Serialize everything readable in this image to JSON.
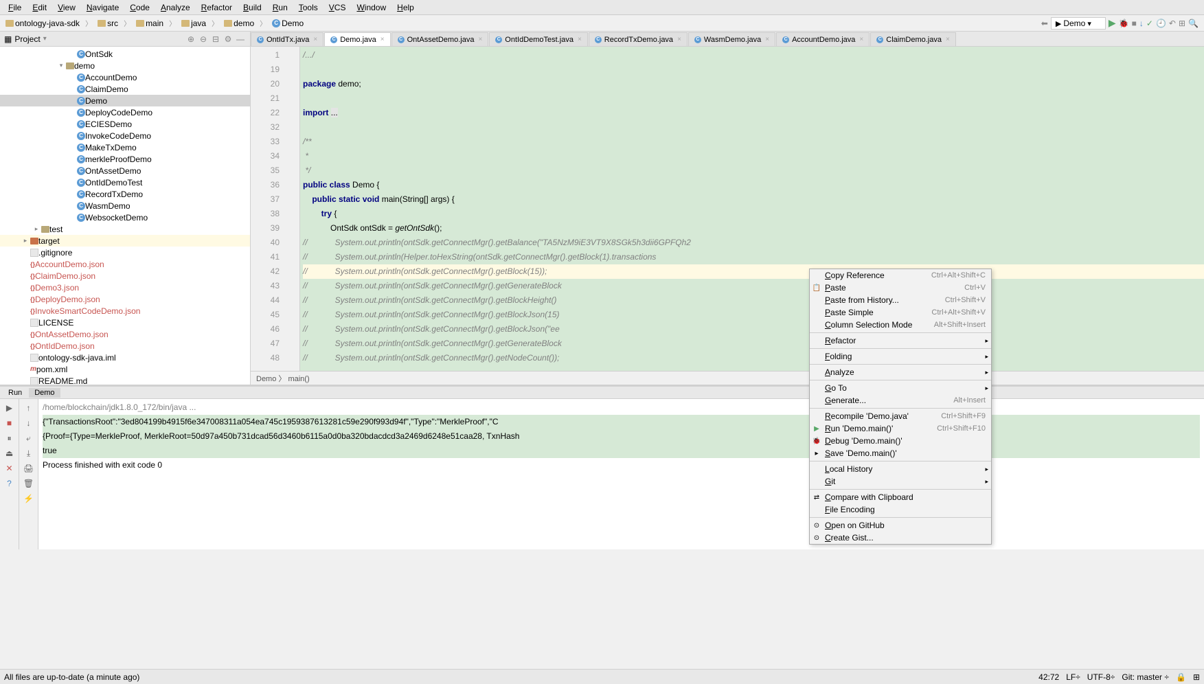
{
  "menus": [
    "File",
    "Edit",
    "View",
    "Navigate",
    "Code",
    "Analyze",
    "Refactor",
    "Build",
    "Run",
    "Tools",
    "VCS",
    "Window",
    "Help"
  ],
  "breadcrumbs": [
    {
      "icon": "folder",
      "label": "ontology-java-sdk"
    },
    {
      "icon": "folder",
      "label": "src"
    },
    {
      "icon": "folder",
      "label": "main"
    },
    {
      "icon": "folder",
      "label": "java"
    },
    {
      "icon": "folder",
      "label": "demo"
    },
    {
      "icon": "class",
      "label": "Demo"
    }
  ],
  "run_config": "Demo",
  "sidebar_title": "Project",
  "tree": {
    "items": [
      {
        "indent": 3,
        "icon": "class",
        "label": "OntSdk"
      },
      {
        "indent": 2,
        "icon": "pkg",
        "label": "demo",
        "expander": "▾"
      },
      {
        "indent": 3,
        "icon": "class",
        "label": "AccountDemo"
      },
      {
        "indent": 3,
        "icon": "class",
        "label": "ClaimDemo"
      },
      {
        "indent": 3,
        "icon": "class",
        "label": "Demo",
        "selected": true
      },
      {
        "indent": 3,
        "icon": "class",
        "label": "DeployCodeDemo"
      },
      {
        "indent": 3,
        "icon": "class",
        "label": "ECIESDemo"
      },
      {
        "indent": 3,
        "icon": "class",
        "label": "InvokeCodeDemo"
      },
      {
        "indent": 3,
        "icon": "class",
        "label": "MakeTxDemo"
      },
      {
        "indent": 3,
        "icon": "class",
        "label": "merkleProofDemo"
      },
      {
        "indent": 3,
        "icon": "class",
        "label": "OntAssetDemo"
      },
      {
        "indent": 3,
        "icon": "class",
        "label": "OntIdDemoTest"
      },
      {
        "indent": 3,
        "icon": "class",
        "label": "RecordTxDemo"
      },
      {
        "indent": 3,
        "icon": "class",
        "label": "WasmDemo"
      },
      {
        "indent": 3,
        "icon": "class",
        "label": "WebsocketDemo"
      },
      {
        "indent": "top",
        "icon": "pkg",
        "label": "test",
        "expander": "▸"
      },
      {
        "indent": "root",
        "icon": "folder-ex",
        "label": "target",
        "expander": "▸",
        "highlighted": true
      },
      {
        "indent": "root",
        "icon": "file",
        "label": ".gitignore"
      },
      {
        "indent": "root",
        "icon": "json",
        "label": "AccountDemo.json",
        "color": "#c75450"
      },
      {
        "indent": "root",
        "icon": "json",
        "label": "ClaimDemo.json",
        "color": "#c75450"
      },
      {
        "indent": "root",
        "icon": "json",
        "label": "Demo3.json",
        "color": "#c75450"
      },
      {
        "indent": "root",
        "icon": "json",
        "label": "DeployDemo.json",
        "color": "#c75450"
      },
      {
        "indent": "root",
        "icon": "json",
        "label": "InvokeSmartCodeDemo.json",
        "color": "#c75450"
      },
      {
        "indent": "root",
        "icon": "file",
        "label": "LICENSE"
      },
      {
        "indent": "root",
        "icon": "json",
        "label": "OntAssetDemo.json",
        "color": "#c75450"
      },
      {
        "indent": "root",
        "icon": "json",
        "label": "OntIdDemo.json",
        "color": "#c75450"
      },
      {
        "indent": "root",
        "icon": "file",
        "label": "ontology-sdk-java.iml"
      },
      {
        "indent": "root",
        "icon": "maven",
        "label": "pom.xml"
      },
      {
        "indent": "root",
        "icon": "file",
        "label": "README.md"
      }
    ]
  },
  "tabs": [
    {
      "label": "OntIdTx.java"
    },
    {
      "label": "Demo.java",
      "active": true
    },
    {
      "label": "OntAssetDemo.java"
    },
    {
      "label": "OntIdDemoTest.java"
    },
    {
      "label": "RecordTxDemo.java"
    },
    {
      "label": "WasmDemo.java"
    },
    {
      "label": "AccountDemo.java"
    },
    {
      "label": "ClaimDemo.java"
    }
  ],
  "gutter_lines": [
    "1",
    "19",
    "20",
    "21",
    "22",
    "32",
    "33",
    "34",
    "35",
    "36",
    "37",
    "38",
    "39",
    "40",
    "41",
    "42",
    "43",
    "44",
    "45",
    "46",
    "47",
    "48"
  ],
  "code_lines": [
    {
      "html": "<span class='comment'>/.../</span>"
    },
    {
      "html": ""
    },
    {
      "html": "<span class='kw'>package</span> demo;"
    },
    {
      "html": ""
    },
    {
      "html": "<span class='kw'>import</span> <span style='background:#e4e4e4'>...</span>"
    },
    {
      "html": ""
    },
    {
      "html": "<span class='comment'>/**</span>"
    },
    {
      "html": "<span class='comment'> *</span>"
    },
    {
      "html": "<span class='comment'> */</span>"
    },
    {
      "html": "<span class='kw'>public class</span> Demo {"
    },
    {
      "html": "    <span class='kw'>public static void</span> main(String[] args) {"
    },
    {
      "html": "        <span class='kw'>try</span> {"
    },
    {
      "html": "            OntSdk ontSdk = <span class='method-call'>getOntSdk</span>();"
    },
    {
      "html": "<span class='comment'>//            System.out.println(ontSdk.getConnectMgr().getBalance(\"TA5NzM9iE3VT9X8SGk5h3dii6GPFQh2</span>"
    },
    {
      "html": "<span class='comment'>//            System.out.println(Helper.toHexString(ontSdk.getConnectMgr().getBlock(1).transactions</span>"
    },
    {
      "html": "<span class='comment'>//            System.out.println(ontSdk.getConnectMgr().getBlock(15));</span>",
      "current": true
    },
    {
      "html": "<span class='comment'>//            System.out.println(ontSdk.getConnectMgr().getGenerateBlock</span>"
    },
    {
      "html": "<span class='comment'>//            System.out.println(ontSdk.getConnectMgr().getBlockHeight()</span>"
    },
    {
      "html": "<span class='comment'>//            System.out.println(ontSdk.getConnectMgr().getBlockJson(15)</span>"
    },
    {
      "html": "<span class='comment'>//            System.out.println(ontSdk.getConnectMgr().getBlockJson(\"ee</span>"
    },
    {
      "html": "<span class='comment'>//            System.out.println(ontSdk.getConnectMgr().getGenerateBlock</span>"
    },
    {
      "html": "<span class='comment'>//            System.out.println(ontSdk.getConnectMgr().getNodeCount());</span>"
    }
  ],
  "code_breadcrumb": "Demo  〉 main()",
  "run_tabs": [
    "Run",
    "Demo"
  ],
  "console_lines": [
    {
      "cls": "cmd",
      "text": "/home/blockchain/jdk1.8.0_172/bin/java ..."
    },
    {
      "cls": "out hl",
      "text": "{\"TransactionsRoot\":\"3ed804199b4915f6e347008311a054ea745c1959387613281c59e290f993d94f\",\"Type\":\"MerkleProof\",\"C"
    },
    {
      "cls": "out hl",
      "text": "{Proof={Type=MerkleProof, MerkleRoot=50d97a450b731dcad56d3460b6115a0d0ba320bdacdcd3a2469d6248e51caa28, TxnHash"
    },
    {
      "cls": "out hl",
      "text": "true"
    },
    {
      "cls": "out",
      "text": ""
    },
    {
      "cls": "out",
      "text": "Process finished with exit code 0"
    }
  ],
  "context_menu": [
    {
      "label": "Copy Reference",
      "shortcut": "Ctrl+Alt+Shift+C"
    },
    {
      "label": "Paste",
      "shortcut": "Ctrl+V",
      "icon": "📋"
    },
    {
      "label": "Paste from History...",
      "shortcut": "Ctrl+Shift+V"
    },
    {
      "label": "Paste Simple",
      "shortcut": "Ctrl+Alt+Shift+V"
    },
    {
      "label": "Column Selection Mode",
      "shortcut": "Alt+Shift+Insert"
    },
    {
      "sep": true
    },
    {
      "label": "Refactor",
      "arrow": true
    },
    {
      "sep": true
    },
    {
      "label": "Folding",
      "arrow": true
    },
    {
      "sep": true
    },
    {
      "label": "Analyze",
      "arrow": true
    },
    {
      "sep": true
    },
    {
      "label": "Go To",
      "arrow": true
    },
    {
      "label": "Generate...",
      "shortcut": "Alt+Insert"
    },
    {
      "sep": true
    },
    {
      "label": "Recompile 'Demo.java'",
      "shortcut": "Ctrl+Shift+F9"
    },
    {
      "label": "Run 'Demo.main()'",
      "shortcut": "Ctrl+Shift+F10",
      "icon": "▶",
      "iconcls": "play"
    },
    {
      "label": "Debug 'Demo.main()'",
      "icon": "🐞",
      "iconcls": "debug"
    },
    {
      "label": "Save 'Demo.main()'",
      "icon": "▸"
    },
    {
      "sep": true
    },
    {
      "label": "Local History",
      "arrow": true
    },
    {
      "label": "Git",
      "arrow": true
    },
    {
      "sep": true
    },
    {
      "label": "Compare with Clipboard",
      "icon": "⇄"
    },
    {
      "label": "File Encoding"
    },
    {
      "sep": true
    },
    {
      "label": "Open on GitHub",
      "icon": "⊙"
    },
    {
      "label": "Create Gist...",
      "icon": "⊙"
    }
  ],
  "status": {
    "left": "All files are up-to-date (a minute ago)",
    "right": [
      "42:72",
      "LF÷",
      "UTF-8÷",
      "Git: master ÷",
      "🔒",
      "⊞"
    ]
  }
}
